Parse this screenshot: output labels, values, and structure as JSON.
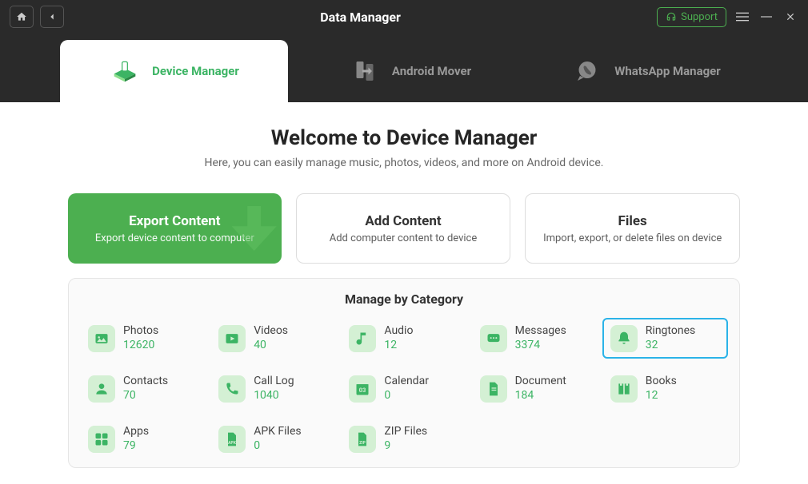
{
  "header": {
    "title": "Data Manager",
    "support": "Support"
  },
  "tabs": [
    {
      "label": "Device Manager",
      "active": true
    },
    {
      "label": "Android Mover",
      "active": false
    },
    {
      "label": "WhatsApp Manager",
      "active": false
    }
  ],
  "welcome": {
    "title": "Welcome to Device Manager",
    "subtitle": "Here, you can easily manage music, photos, videos, and more on Android device."
  },
  "cards": {
    "export": {
      "title": "Export Content",
      "sub": "Export device content to computer"
    },
    "add": {
      "title": "Add Content",
      "sub": "Add computer content to device"
    },
    "files": {
      "title": "Files",
      "sub": "Import, export, or delete files on device"
    }
  },
  "category": {
    "title": "Manage by Category",
    "items": [
      {
        "label": "Photos",
        "count": "12620",
        "icon": "photos"
      },
      {
        "label": "Videos",
        "count": "40",
        "icon": "videos"
      },
      {
        "label": "Audio",
        "count": "12",
        "icon": "audio"
      },
      {
        "label": "Messages",
        "count": "3374",
        "icon": "messages"
      },
      {
        "label": "Ringtones",
        "count": "32",
        "icon": "ringtones",
        "highlight": true
      },
      {
        "label": "Contacts",
        "count": "70",
        "icon": "contacts"
      },
      {
        "label": "Call Log",
        "count": "1040",
        "icon": "calllog"
      },
      {
        "label": "Calendar",
        "count": "0",
        "icon": "calendar"
      },
      {
        "label": "Document",
        "count": "184",
        "icon": "document"
      },
      {
        "label": "Books",
        "count": "12",
        "icon": "books"
      },
      {
        "label": "Apps",
        "count": "79",
        "icon": "apps"
      },
      {
        "label": "APK Files",
        "count": "0",
        "icon": "apk"
      },
      {
        "label": "ZIP Files",
        "count": "9",
        "icon": "zip"
      }
    ]
  }
}
